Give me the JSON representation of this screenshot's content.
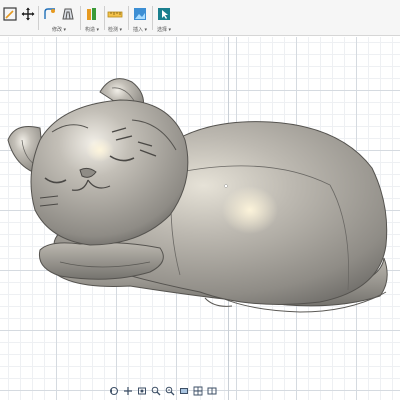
{
  "toolbar": {
    "groups": [
      {
        "label": "",
        "icons": [
          "sketch-icon",
          "move-icon"
        ]
      },
      {
        "label": "修改 ▾",
        "icons": [
          "modify-fillet-icon",
          "modify-shell-icon"
        ]
      },
      {
        "label": "构造 ▾",
        "icons": [
          "construct-plane-icon"
        ]
      },
      {
        "label": "检测 ▾",
        "icons": [
          "inspect-measure-icon"
        ]
      },
      {
        "label": "插入 ▾",
        "icons": [
          "insert-image-icon"
        ]
      },
      {
        "label": "选择 ▾",
        "icons": [
          "select-icon"
        ]
      }
    ]
  },
  "colors": {
    "toolbar_bg": "#f6f6f6",
    "grid_major": "#d5dae0",
    "grid_minor": "#eef0f3",
    "model_body": "#9d9a94",
    "model_highlight": "#e8e4d8",
    "accent_blue": "#1f6fb8",
    "accent_teal": "#1a7f8e",
    "accent_green": "#3a9a3a",
    "accent_orange": "#e69a21"
  },
  "nav": {
    "icons": [
      "orbit-icon",
      "pan-icon",
      "look-at-icon",
      "zoom-icon",
      "fit-icon",
      "display-settings-icon",
      "grid-settings-icon",
      "viewports-icon"
    ]
  }
}
